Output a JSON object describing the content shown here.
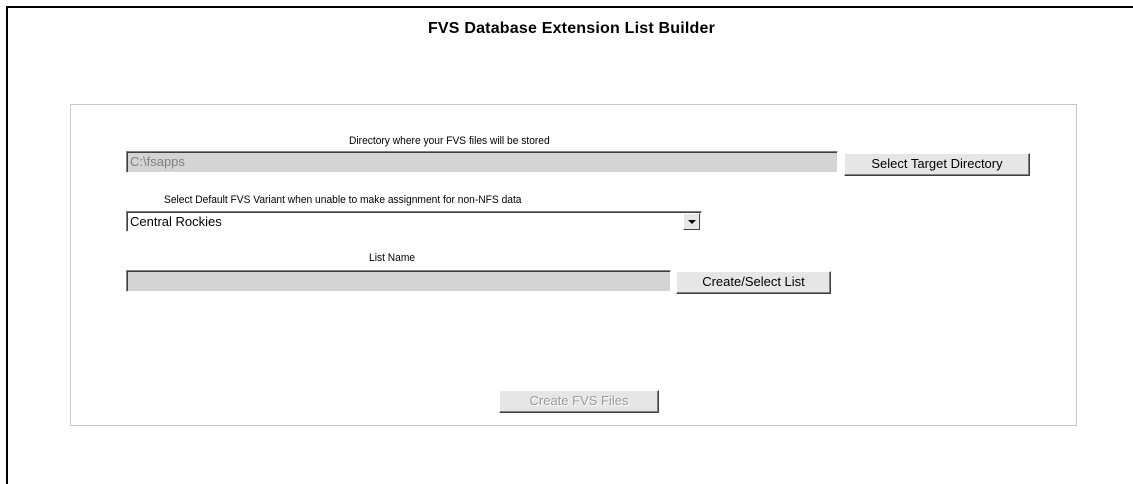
{
  "header": {
    "title": "FVS Database Extension List Builder"
  },
  "directory": {
    "label": "Directory where your FVS files will be stored",
    "value": "C:\\fsapps",
    "button_label": "Select Target Directory"
  },
  "variant": {
    "label": "Select Default FVS Variant when unable to make assignment for non-NFS data",
    "selected": "Central Rockies",
    "dropdown_icon": "chevron-down-icon"
  },
  "list": {
    "label": "List Name",
    "value": "",
    "button_label": "Create/Select List"
  },
  "footer": {
    "create_button_label": "Create FVS Files"
  }
}
